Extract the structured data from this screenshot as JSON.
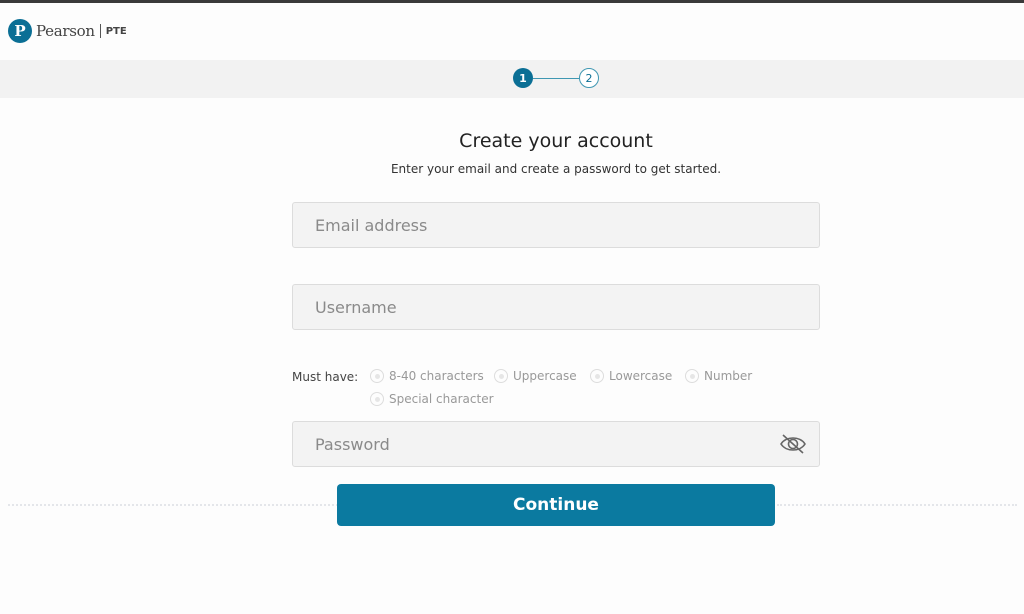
{
  "header": {
    "logo_mark": "P",
    "brand": "Pearson",
    "product": "PTE"
  },
  "stepper": {
    "steps": [
      {
        "label": "1",
        "state": "active"
      },
      {
        "label": "2",
        "state": "inactive"
      }
    ],
    "current_step": 1,
    "total_steps": 2
  },
  "form": {
    "title": "Create your account",
    "subtitle": "Enter your email and create a password to get started.",
    "email": {
      "placeholder": "Email address",
      "value": ""
    },
    "username": {
      "placeholder": "Username",
      "value": ""
    },
    "password": {
      "placeholder": "Password",
      "value": "",
      "toggle_icon": "eye-slash-icon"
    },
    "rules_label": "Must have:",
    "rules": [
      {
        "label": "8-40 characters",
        "met": false
      },
      {
        "label": "Uppercase",
        "met": false
      },
      {
        "label": "Lowercase",
        "met": false
      },
      {
        "label": "Number",
        "met": false
      },
      {
        "label": "Special character",
        "met": false
      }
    ],
    "continue_label": "Continue"
  },
  "colors": {
    "brand": "#0b6f95",
    "button": "#0b7aa0",
    "field_bg": "#f3f3f3",
    "band_bg": "#f2f2f2"
  }
}
